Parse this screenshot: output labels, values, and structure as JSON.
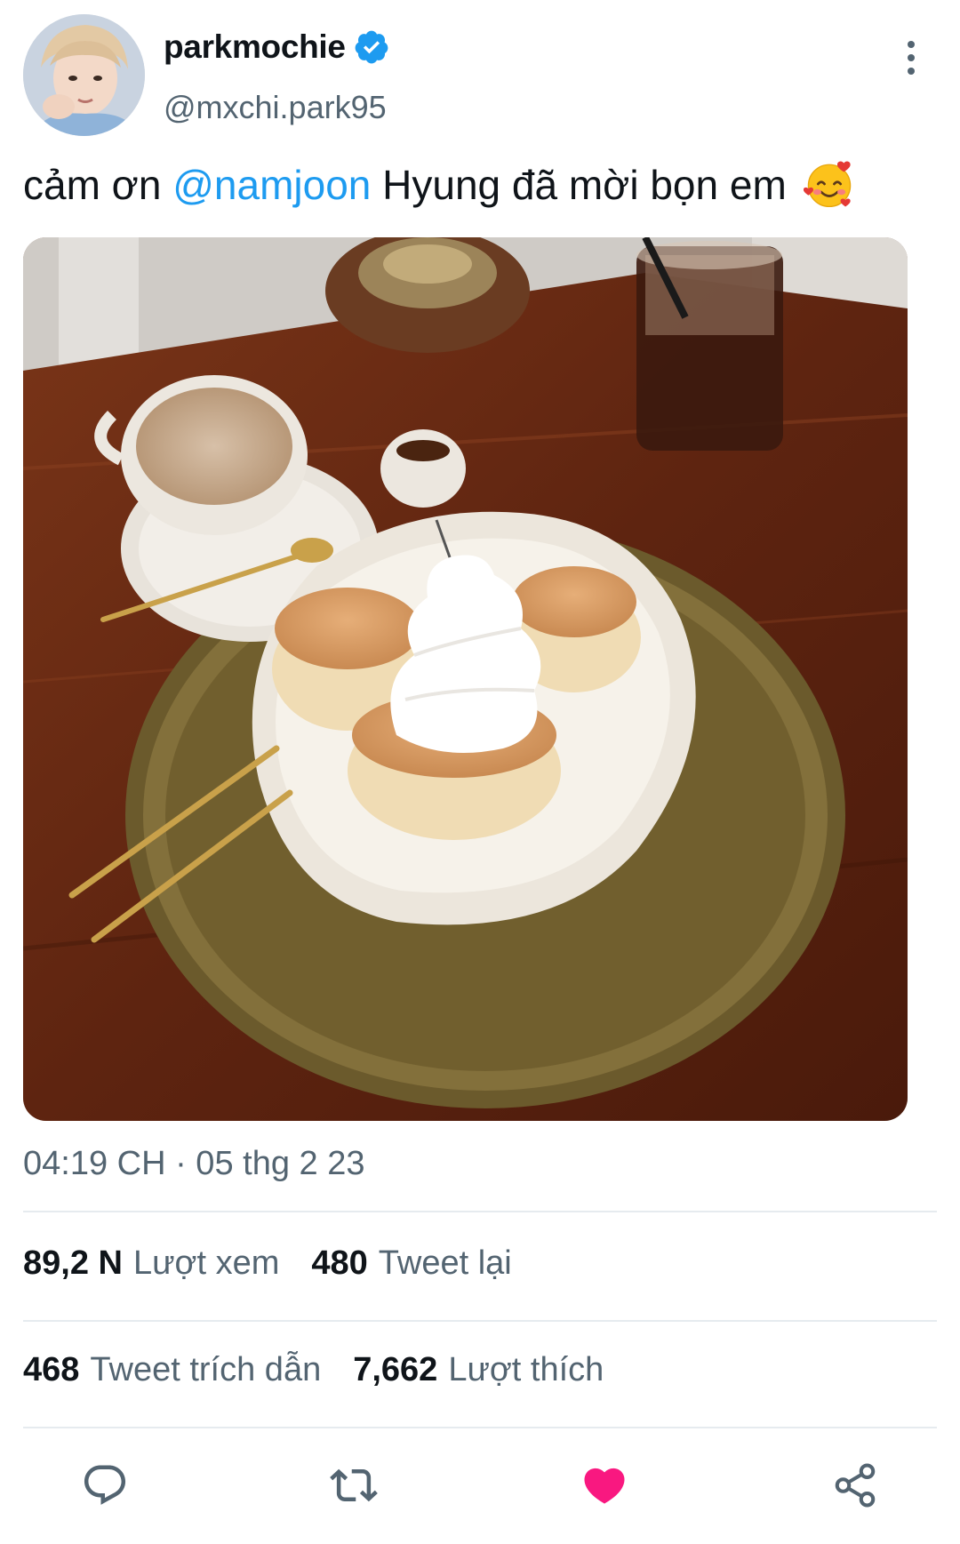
{
  "tweet": {
    "display_name": "parkmochie",
    "verified": true,
    "handle": "@mxchi.park95",
    "text_prefix": "cảm ơn ",
    "mention": "@namjoon",
    "text_suffix": " Hyung đã mời bọn em",
    "emoji": "smiling-face-with-hearts",
    "timestamp": "04:19 CH · 05 thg 2 23"
  },
  "stats": {
    "views_count": "89,2 N",
    "views_label": "Lượt xem",
    "retweets_count": "480",
    "retweets_label": "Tweet lại",
    "quotes_count": "468",
    "quotes_label": "Tweet trích dẫn",
    "likes_count": "7,662",
    "likes_label": "Lượt thích"
  },
  "actions": [
    {
      "icon": "reply-icon"
    },
    {
      "icon": "retweet-icon"
    },
    {
      "icon": "heart-icon",
      "active": true
    },
    {
      "icon": "share-icon"
    }
  ],
  "colors": {
    "accent": "#1d9bf0",
    "like_active": "#f91880",
    "secondary_text": "#536471"
  }
}
